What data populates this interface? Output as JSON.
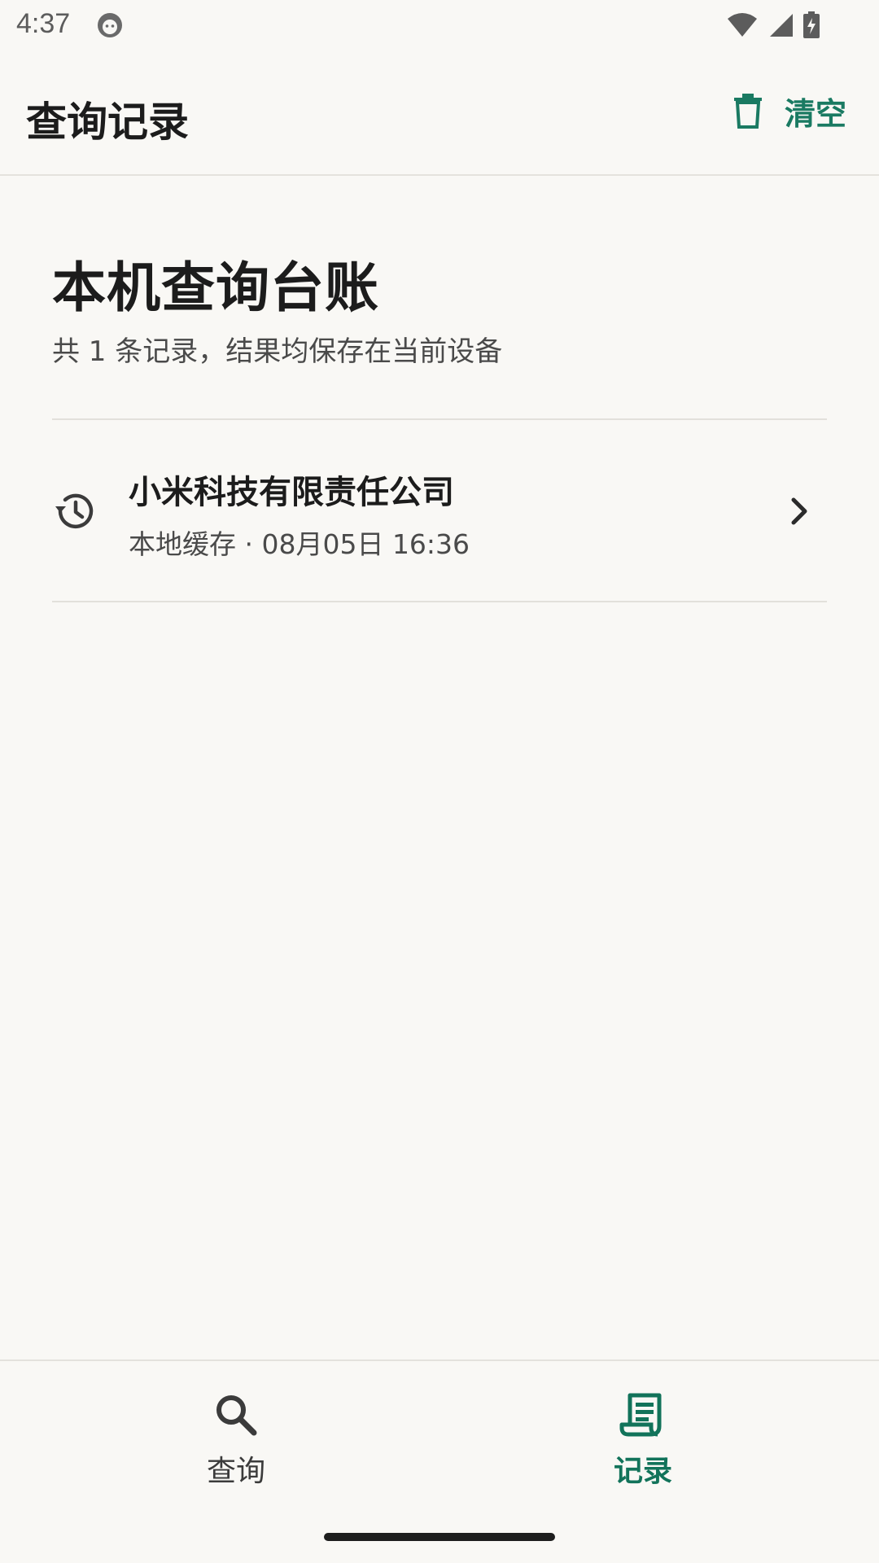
{
  "status_bar": {
    "time": "4:37",
    "icons": [
      "cat-app-icon",
      "wifi-icon",
      "signal-icon",
      "battery-charging-icon"
    ]
  },
  "app_bar": {
    "title": "查询记录",
    "clear_label": "清空",
    "clear_icon": "trash-icon"
  },
  "section": {
    "title": "本机查询台账",
    "subtitle": "共 1 条记录，结果均保存在当前设备"
  },
  "records": [
    {
      "icon": "history-icon",
      "name": "小米科技有限责任公司",
      "meta": "本地缓存 · 08月05日 16:36"
    }
  ],
  "bottom_nav": {
    "items": [
      {
        "label": "查询",
        "icon": "search-icon",
        "active": false
      },
      {
        "label": "记录",
        "icon": "receipt-icon",
        "active": true
      }
    ]
  },
  "colors": {
    "accent": "#1a7a62",
    "background": "#f9f8f5",
    "text_primary": "#1c1c1c",
    "text_secondary": "#4a4a4a"
  }
}
